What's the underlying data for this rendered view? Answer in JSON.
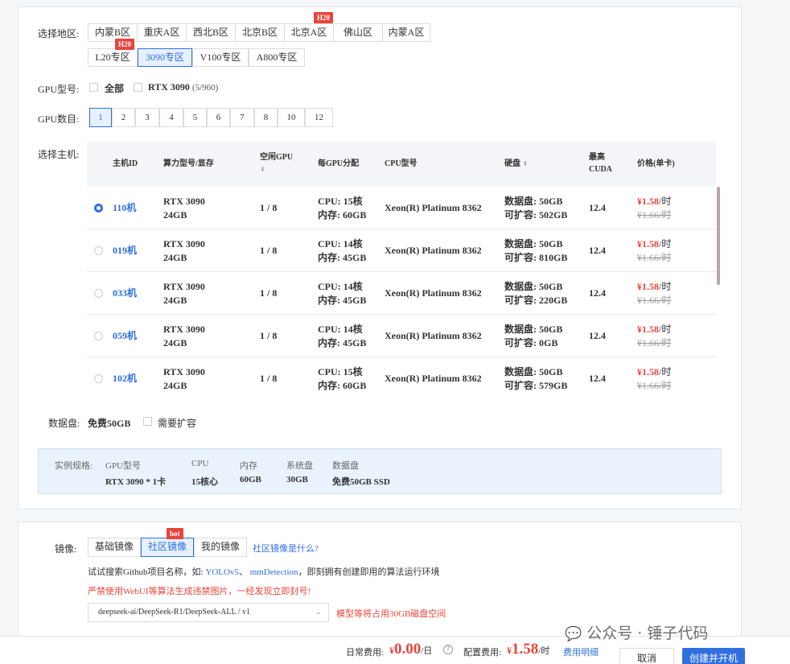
{
  "region": {
    "label": "选择地区:",
    "row1": [
      "内蒙B区",
      "重庆A区",
      "西北B区",
      "北京B区",
      "北京A区",
      "佛山区",
      "内蒙A区"
    ],
    "row2": [
      "L20专区",
      "3090专区",
      "V100专区",
      "A800专区"
    ],
    "tag_beijing_a": "H20",
    "tag_3090": "H20"
  },
  "gpu_type": {
    "label": "GPU型号:",
    "all": "全部",
    "model": "RTX 3090",
    "model_count": "(5/960)"
  },
  "gpu_count": {
    "label": "GPU数目:",
    "options": [
      "1",
      "2",
      "3",
      "4",
      "5",
      "6",
      "7",
      "8",
      "10",
      "12"
    ],
    "selected": "1"
  },
  "host": {
    "label": "选择主机:",
    "columns": {
      "id": "主机ID",
      "gpu": "算力型号/显存",
      "free_gpu": "空闲GPU",
      "per_gpu": "每GPU分配",
      "cpu_model": "CPU型号",
      "disk": "硬盘",
      "cuda": "最高CUDA",
      "price": "价格(单卡)"
    },
    "rows": [
      {
        "id": "110机",
        "gpu1": "RTX 3090",
        "gpu2": "24GB",
        "free": "1 / 8",
        "cpu": "CPU: 15核",
        "mem": "内存: 60GB",
        "cpu_model": "Xeon(R) Platinum 8362",
        "disk1": "数据盘: 50GB",
        "disk2": "可扩容: 502GB",
        "cuda": "12.4",
        "price_now": "¥1.58",
        "price_unit": "/时",
        "price_old": "¥1.66/时"
      },
      {
        "id": "019机",
        "gpu1": "RTX 3090",
        "gpu2": "24GB",
        "free": "1 / 8",
        "cpu": "CPU: 14核",
        "mem": "内存: 45GB",
        "cpu_model": "Xeon(R) Platinum 8362",
        "disk1": "数据盘: 50GB",
        "disk2": "可扩容: 810GB",
        "cuda": "12.4",
        "price_now": "¥1.58",
        "price_unit": "/时",
        "price_old": "¥1.66/时"
      },
      {
        "id": "033机",
        "gpu1": "RTX 3090",
        "gpu2": "24GB",
        "free": "1 / 8",
        "cpu": "CPU: 14核",
        "mem": "内存: 45GB",
        "cpu_model": "Xeon(R) Platinum 8362",
        "disk1": "数据盘: 50GB",
        "disk2": "可扩容: 220GB",
        "cuda": "12.4",
        "price_now": "¥1.58",
        "price_unit": "/时",
        "price_old": "¥1.66/时"
      },
      {
        "id": "059机",
        "gpu1": "RTX 3090",
        "gpu2": "24GB",
        "free": "1 / 8",
        "cpu": "CPU: 14核",
        "mem": "内存: 45GB",
        "cpu_model": "Xeon(R) Platinum 8362",
        "disk1": "数据盘: 50GB",
        "disk2": "可扩容: 0GB",
        "cuda": "12.4",
        "price_now": "¥1.58",
        "price_unit": "/时",
        "price_old": "¥1.66/时"
      },
      {
        "id": "102机",
        "gpu1": "RTX 3090",
        "gpu2": "24GB",
        "free": "1 / 8",
        "cpu": "CPU: 15核",
        "mem": "内存: 60GB",
        "cpu_model": "Xeon(R) Platinum 8362",
        "disk1": "数据盘: 50GB",
        "disk2": "可扩容: 579GB",
        "cuda": "12.4",
        "price_now": "¥1.58",
        "price_unit": "/时",
        "price_old": "¥1.66/时"
      }
    ]
  },
  "data_disk": {
    "label": "数据盘:",
    "value": "免费50GB",
    "expand": "需要扩容"
  },
  "spec": {
    "label": "实例规格:",
    "gpu_k": "GPU型号",
    "gpu_v": "RTX 3090 * 1卡",
    "cpu_k": "CPU",
    "cpu_v": "15核心",
    "mem_k": "内存",
    "mem_v": "60GB",
    "sys_k": "系统盘",
    "sys_v": "30GB",
    "data_k": "数据盘",
    "data_v": "免费50GB SSD"
  },
  "image": {
    "label": "镜像:",
    "tabs": [
      "基础镜像",
      "社区镜像",
      "我的镜像"
    ],
    "hot": "hot",
    "what_link": "社区镜像是什么?",
    "hint_prefix": "试试搜索Github项目名称，如:",
    "hint_link1": "YOLOv5",
    "hint_sep": "、",
    "hint_link2": "mmDetection",
    "hint_suffix": "，即刻拥有创建即用的算法运行环境",
    "warning": "严禁使用WebUI等算法生成违禁图片，一经发现立即封号!",
    "selected": "deepseek-ai/DeepSeek-R1/DeepSeek-ALL / v1",
    "disk_note": "模型等将占用30GB磁盘空间"
  },
  "footer": {
    "daily_label": "日常费用:",
    "daily_currency": "¥",
    "daily_value": "0.00",
    "daily_unit": "/日",
    "config_label": "配置费用:",
    "config_currency": "¥",
    "config_value": "1.58",
    "config_unit": "/时",
    "detail_link": "费用明细",
    "cancel": "取消",
    "create": "创建并开机"
  },
  "watermark": "公众号 · 锤子代码",
  "colors": {
    "accent": "#2f6fe0",
    "danger": "#e8453c"
  }
}
